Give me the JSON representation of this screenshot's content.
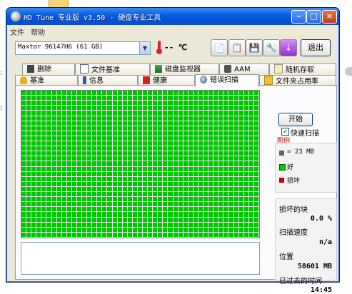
{
  "background": {
    "left_marks": [
      ":",
      ":"
    ]
  },
  "window": {
    "title": "HD Tune 专业版 v3.50 - 硬盘专业工具",
    "menu": [
      "文件",
      "帮助"
    ]
  },
  "toolbar": {
    "drive": "Maxtor 96147H6 (61 GB)",
    "temperature": "-- ℃",
    "exit_label": "退出",
    "icons": [
      "copy-text-icon",
      "copy-screenshot-icon",
      "save-icon",
      "options-icon",
      "download-icon"
    ]
  },
  "tabs_row1": [
    {
      "label": "删除",
      "icon": "trash-icon"
    },
    {
      "label": "文件基准",
      "icon": "file-benchmark-icon"
    },
    {
      "label": "磁盘监视器",
      "icon": "disk-monitor-icon"
    },
    {
      "label": "AAM",
      "icon": "speaker-icon"
    },
    {
      "label": "随机存取",
      "icon": "random-access-icon"
    }
  ],
  "tabs_row2": [
    {
      "label": "基准",
      "icon": "benchmark-icon"
    },
    {
      "label": "信息",
      "icon": "info-icon"
    },
    {
      "label": "健康",
      "icon": "health-cross-icon"
    },
    {
      "label": "错误扫描",
      "icon": "magnifier-icon",
      "active": true
    },
    {
      "label": "文件夹占用率",
      "icon": "folder-icon"
    }
  ],
  "scan": {
    "start_label": "开始",
    "quick_scan_label": "快速扫描",
    "quick_scan_checked": true,
    "legend_title": "图例",
    "legend": {
      "block_size": "= 23 MB",
      "good": "好",
      "damaged": "损坏"
    },
    "damaged_blocks_label": "损坏的块",
    "damaged_blocks_value": "0.0 %",
    "scan_speed_label": "扫描速度",
    "scan_speed_value": "n/a",
    "position_label": "位置",
    "position_value": "58601 MB",
    "elapsed_label": "已过去的时间",
    "elapsed_value": "14:45",
    "grid_rows": 29,
    "grid_cols": 47,
    "status_text": ""
  },
  "colors": {
    "good": "#00c800",
    "damaged": "#cc0000",
    "block": "#606060",
    "titlebar": "#0a5fe0"
  }
}
